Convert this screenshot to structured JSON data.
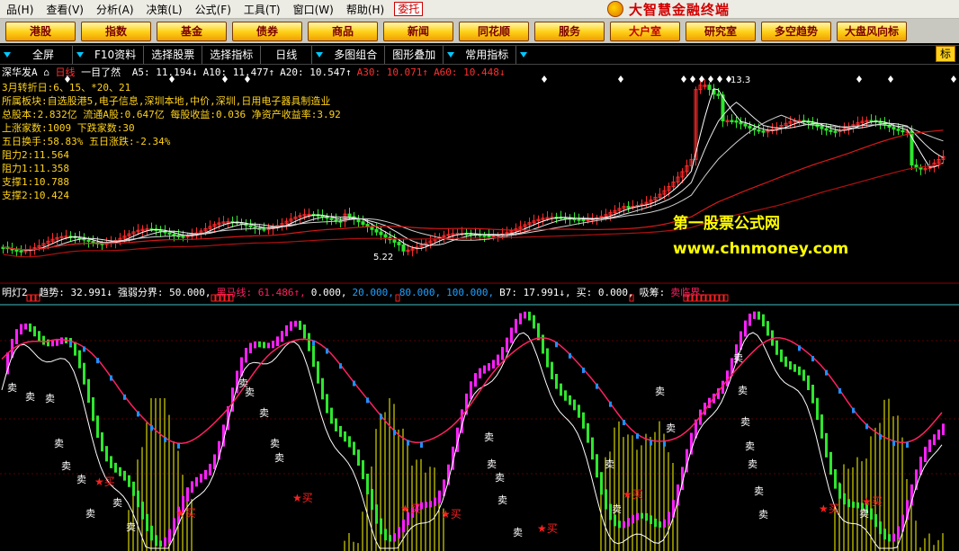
{
  "menu": {
    "items": [
      "品(H)",
      "查看(V)",
      "分析(A)",
      "决策(L)",
      "公式(F)",
      "工具(T)",
      "窗口(W)",
      "帮助(H)"
    ],
    "entrust": "委托",
    "app_title": "大智慧金融终端"
  },
  "nav": {
    "buttons": [
      "港股",
      "指数",
      "基金",
      "债券",
      "商品",
      "新闻",
      "同花顺",
      "服务",
      "大户室",
      "研究室",
      "多空趋势",
      "大盘风向标"
    ]
  },
  "toolbar": {
    "tabs": [
      "全屏",
      "F10资料",
      "选择股票",
      "选择指标",
      "日线",
      "多图组合",
      "图形叠加",
      "常用指标"
    ],
    "corner": "标"
  },
  "main": {
    "stock": "深华发A",
    "period": "日线",
    "indicator_name": "一目了然",
    "ma_readouts": [
      {
        "label": "A5:",
        "value": "11.194",
        "arrow": "↓",
        "color": "#ffffff"
      },
      {
        "label": "A10:",
        "value": "11.477",
        "arrow": "↑",
        "color": "#ffffff"
      },
      {
        "label": "A20:",
        "value": "10.547",
        "arrow": "↑",
        "color": "#ffffff"
      },
      {
        "label": "A30:",
        "value": "10.071",
        "arrow": "↑",
        "color": "#ff3030"
      },
      {
        "label": "A60:",
        "value": "10.448",
        "arrow": "↓",
        "color": "#ff3030"
      }
    ],
    "info_lines": [
      "3月转折日:6、15、*20、21",
      "所属板块:自选股港5,电子信息,深圳本地,中价,深圳,日用电子器具制造业",
      "总股本:2.832亿  流通A股:0.647亿  每股收益:0.036  净资产收益率:3.92",
      "上涨家数:1009      下跌家数:30",
      "五日换手:58.83%    五日涨跌:-2.34%",
      "阻力2:11.564",
      "阻力1:11.358",
      "支撑1:10.788",
      "支撑2:10.424"
    ],
    "peak_label": "13.3",
    "low_label": "5.22",
    "watermark_cn": "第一股票公式网",
    "watermark_url": "www.chnmoney.com"
  },
  "sub": {
    "name": "明灯2",
    "readouts": [
      {
        "text": "趋势: 32.991↓",
        "color": "#ffffff"
      },
      {
        "text": "强弱分界: 50.000,",
        "color": "#ffffff"
      },
      {
        "text": "黑马线: 61.486↑,",
        "color": "#ff2060"
      },
      {
        "text": "0.000,",
        "color": "#ffffff"
      },
      {
        "text": "20.000,",
        "color": "#20a0ff"
      },
      {
        "text": "80.000,",
        "color": "#20a0ff"
      },
      {
        "text": "100.000,",
        "color": "#20a0ff"
      },
      {
        "text": "B7: 17.991↓,",
        "color": "#ffffff"
      },
      {
        "text": "买: 0.000,",
        "color": "#ffffff"
      },
      {
        "text": "吸筹:",
        "color": "#ffffff"
      },
      {
        "text": "卖临界:",
        "color": "#ff2060"
      }
    ],
    "buy_label": "★买",
    "sell_label": "卖"
  },
  "colors": {
    "up": "#ff2a2a",
    "down": "#2ee62e",
    "ma5": "#ffffff",
    "ma20": "#d0d0d0",
    "ma60": "#d81818",
    "pink": "#ff20ff",
    "blue": "#1e90ff",
    "yellow": "#ffff00",
    "crimson": "#ff2060"
  }
}
